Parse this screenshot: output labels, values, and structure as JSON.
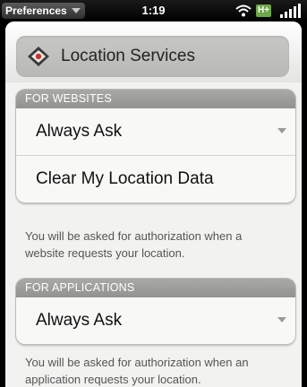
{
  "status_bar": {
    "app_menu_label": "Preferences",
    "time": "1:19",
    "network": "H+"
  },
  "header": {
    "title": "Location Services"
  },
  "websites": {
    "section_label": "FOR WEBSITES",
    "dropdown_value": "Always Ask",
    "clear_button_label": "Clear My Location Data",
    "note": "You will be asked for authorization when a website requests your location."
  },
  "applications": {
    "section_label": "FOR APPLICATIONS",
    "dropdown_value": "Always Ask",
    "note": "You will be asked for authorization when an application requests your location."
  },
  "colors": {
    "group_header": "#a0a09e",
    "network_badge": "#6fa84a"
  }
}
